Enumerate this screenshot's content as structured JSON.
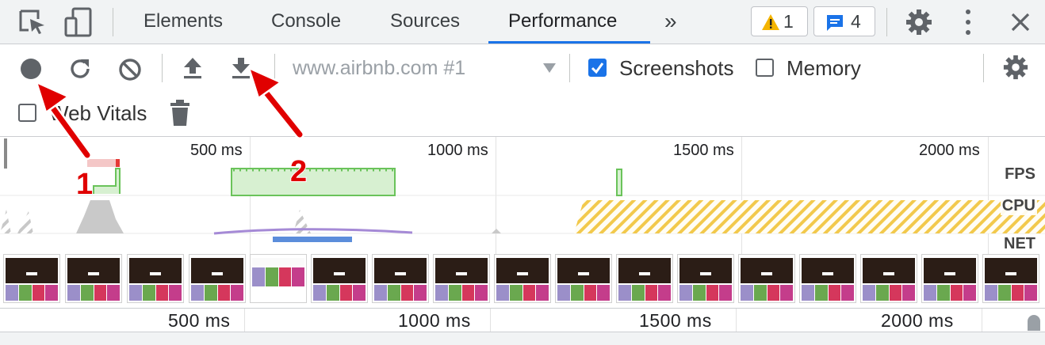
{
  "tabs": {
    "elements": "Elements",
    "console": "Console",
    "sources": "Sources",
    "performance": "Performance",
    "more": "»"
  },
  "badges": {
    "warnings": "1",
    "messages": "4"
  },
  "toolbar": {
    "recording_target": "www.airbnb.com #1",
    "screenshots_label": "Screenshots",
    "memory_label": "Memory",
    "web_vitals_label": "Web Vitals"
  },
  "checkboxes": {
    "screenshots": true,
    "memory": false,
    "web_vitals": false
  },
  "overview": {
    "ticks": [
      "500 ms",
      "1000 ms",
      "1500 ms",
      "2000 ms"
    ],
    "tracks": {
      "fps": "FPS",
      "cpu": "CPU",
      "net": "NET"
    },
    "bottom_ticks": [
      "500 ms",
      "1000 ms",
      "1500 ms",
      "2000 ms"
    ]
  },
  "annotations": {
    "first": "1",
    "second": "2"
  },
  "icons": {
    "inspect": "inspect-element-icon",
    "device": "device-toolbar-icon",
    "record": "record-icon",
    "reload": "reload-profile-icon",
    "clear": "clear-icon",
    "upload": "load-profile-icon",
    "download": "save-profile-icon",
    "settings": "gear-icon",
    "trash": "trash-icon"
  },
  "colors": {
    "accent": "#1a73e8",
    "fps_fill": "#d7f0d1",
    "fps_stroke": "#6ac35a",
    "cpu_scripting": "#f2c94c",
    "net_bar": "#5b8ddb",
    "annotation_red": "#e00000"
  }
}
